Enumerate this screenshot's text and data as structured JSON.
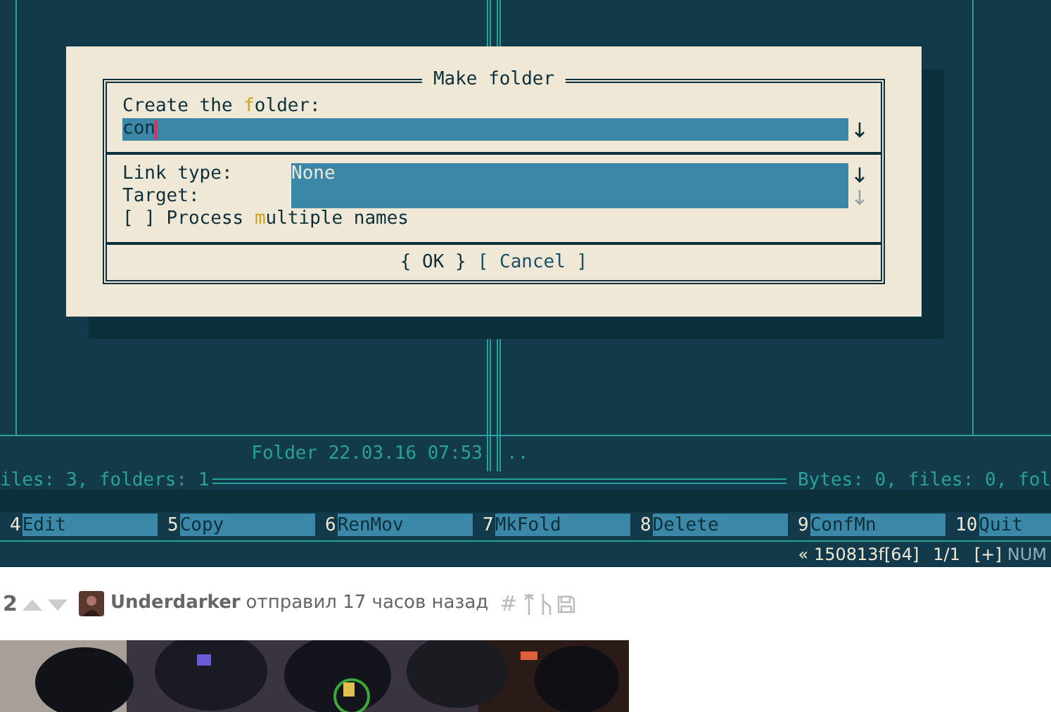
{
  "panels": {
    "left": {
      "info": "Folder 22.03.16 07:53",
      "summary": "iles: 3, folders: 1"
    },
    "right": {
      "info": "..",
      "summary": "Bytes: 0, files: 0, fol"
    }
  },
  "dialog": {
    "title": "Make folder",
    "name_label": {
      "before": "Create the ",
      "hotkey": "f",
      "after": "older:"
    },
    "name_value": "con",
    "link_type_label": "Link type:",
    "link_type_value": "None",
    "target_label": "Target:",
    "multiple": {
      "box": "[ ]",
      "before": " Process ",
      "hotkey": "m",
      "after": "ultiple names",
      "checked": false
    },
    "buttons": [
      {
        "label": "{ OK }",
        "selected": true
      },
      {
        "label": "[ Cancel ]",
        "selected": false
      }
    ]
  },
  "keybar": [
    {
      "number": "4",
      "label": "Edit"
    },
    {
      "number": "5",
      "label": "Copy"
    },
    {
      "number": "6",
      "label": "RenMov"
    },
    {
      "number": "7",
      "label": "MkFold"
    },
    {
      "number": "8",
      "label": "Delete"
    },
    {
      "number": "9",
      "label": "ConfMn"
    },
    {
      "number": "10",
      "label": "Quit"
    }
  ],
  "status_bar": {
    "marker": "«",
    "file": "150813f[64]",
    "page": "1/1",
    "flag": "[+]",
    "mode": "NUM"
  },
  "post": {
    "score": "2",
    "author": "Underdarker",
    "meta": "отправил 17 часов назад",
    "hash": "#"
  }
}
